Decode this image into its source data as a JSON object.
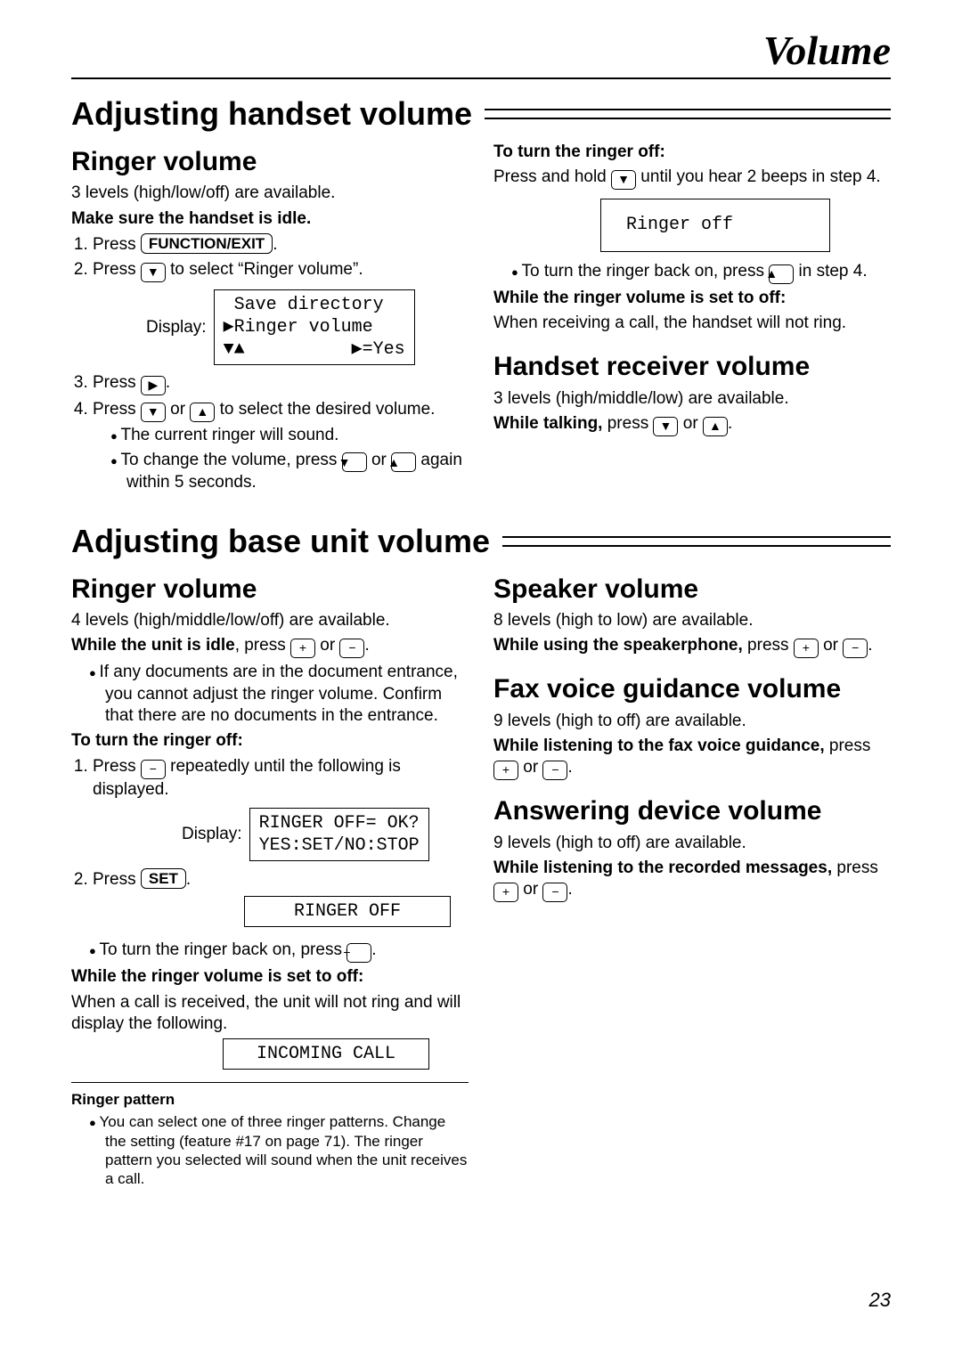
{
  "chapter_title": "Volume",
  "page_number": "23",
  "sec1": {
    "title": "Adjusting handset volume",
    "left": {
      "h2": "Ringer volume",
      "intro": "3 levels (high/low/off) are available.",
      "note": "Make sure the handset is idle.",
      "step1_a": "Press ",
      "key_function": "FUNCTION/EXIT",
      "step1_b": ".",
      "step2_a": "Press ",
      "step2_b": " to select “Ringer volume”.",
      "display_label": "Display:",
      "display_box": " Save directory\n▶Ringer volume\n▼▲          ▶=Yes",
      "step3_a": "Press ",
      "step3_b": ".",
      "step4_a": "Press ",
      "step4_or": " or ",
      "step4_b": " to select the desired volume.",
      "b1": "The current ringer will sound.",
      "b2_a": "To change the volume, press ",
      "b2_or": " or ",
      "b2_b": " again within 5 seconds."
    },
    "right": {
      "h_off": "To turn the ringer off:",
      "off_a": "Press and hold ",
      "off_b": " until you hear 2 beeps in step 4.",
      "display_off": "Ringer off",
      "on_a": "To turn the ringer back on, press ",
      "on_b": " in step 4.",
      "h_while": "While the ringer volume is set to off:",
      "while_text": "When receiving a call, the handset will not ring.",
      "h2": "Handset receiver volume",
      "rx_intro": "3 levels (high/middle/low) are available.",
      "rx_a": "While talking,",
      "rx_b": " press ",
      "rx_or": " or ",
      "rx_c": "."
    }
  },
  "sec2": {
    "title": "Adjusting base unit volume",
    "left": {
      "h2": "Ringer volume",
      "intro": "4 levels (high/middle/low/off) are available.",
      "idle_a": "While the unit is idle",
      "idle_b": ", press ",
      "idle_or": " or ",
      "idle_c": ".",
      "doc_note": "If any documents are in the document entrance, you cannot adjust the ringer volume. Confirm that there are no documents in the entrance.",
      "h_off": "To turn the ringer off:",
      "s1_a": "Press ",
      "s1_b": " repeatedly until the following is displayed.",
      "display_label": "Display:",
      "box1": "RINGER OFF= OK?\nYES:SET/NO:STOP",
      "s2_a": "Press ",
      "key_set": "SET",
      "s2_b": ".",
      "box2": "RINGER OFF",
      "on_a": "To turn the ringer back on, press ",
      "on_b": ".",
      "h_while": "While the ringer volume is set to off:",
      "while_text": "When a call is received, the unit will not ring and will display the following.",
      "box3": "INCOMING CALL",
      "fn_h": "Ringer pattern",
      "fn_text": "You can select one of three ringer patterns. Change the setting (feature #17 on page 71). The ringer pattern you selected will sound when the unit receives a call."
    },
    "right": {
      "h2a": "Speaker volume",
      "spk_intro": "8 levels (high to low) are available.",
      "spk_a": "While using the speakerphone,",
      "spk_b": " press ",
      "spk_or": " or ",
      "spk_c": ".",
      "h2b": "Fax voice guidance volume",
      "fax_intro": "9 levels (high to off) are available.",
      "fax_a": "While listening to the fax voice guidance,",
      "fax_b": " press ",
      "fax_or": " or ",
      "fax_c": ".",
      "h2c": "Answering device volume",
      "ans_intro": "9 levels (high to off) are available.",
      "ans_a": "While listening to the recorded messages,",
      "ans_b": " press ",
      "ans_or": " or ",
      "ans_c": "."
    }
  },
  "glyphs": {
    "down": "▼",
    "up": "▲",
    "play": "▶",
    "plus": "+",
    "minus": "−"
  }
}
